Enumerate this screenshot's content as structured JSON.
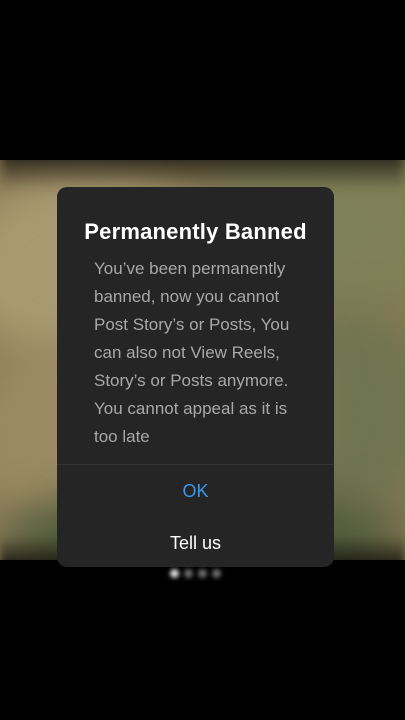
{
  "dialog": {
    "title": "Permanently Banned",
    "message": "You’ve been permanently banned, now you cannot Post Story’s or Posts, You can also not View Reels, Story’s or Posts anymore. You cannot appeal as it is too late",
    "ok_label": "OK",
    "tell_us_label": "Tell us"
  },
  "colors": {
    "dialog_background": "#252525",
    "ok_text": "#3a97e8",
    "title_text": "#ffffff",
    "message_text": "#a8a8a8"
  }
}
